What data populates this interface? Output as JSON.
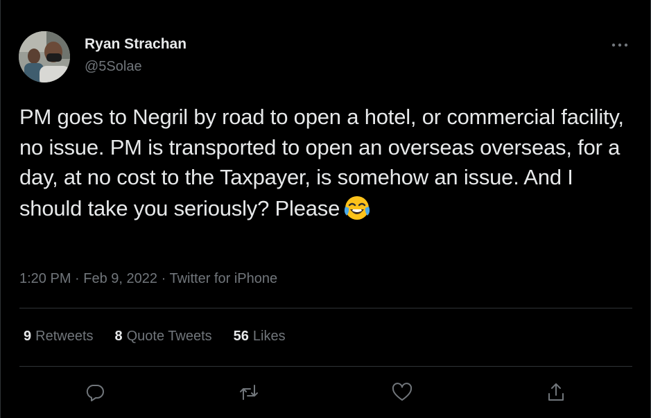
{
  "author": {
    "display_name": "Ryan Strachan",
    "handle": "@5Solae"
  },
  "tweet": {
    "text": "PM goes to Negril by road to open a hotel, or commercial facility, no issue. PM is transported to open an overseas overseas, for a day, at no cost to the Taxpayer, is somehow an issue. And I should take you seriously? Please",
    "emoji": "face-with-tears-of-joy"
  },
  "meta": {
    "time": "1:20 PM",
    "separator": "·",
    "date": "Feb 9, 2022",
    "source": "Twitter for iPhone"
  },
  "stats": {
    "retweets_count": "9",
    "retweets_label": "Retweets",
    "quotes_count": "8",
    "quotes_label": "Quote Tweets",
    "likes_count": "56",
    "likes_label": "Likes"
  },
  "actions": {
    "reply": "reply-icon",
    "retweet": "retweet-icon",
    "like": "heart-icon",
    "share": "share-icon"
  },
  "colors": {
    "background": "#000000",
    "primary_text": "#e7e9ea",
    "secondary_text": "#71767b",
    "divider": "#2f3336"
  }
}
